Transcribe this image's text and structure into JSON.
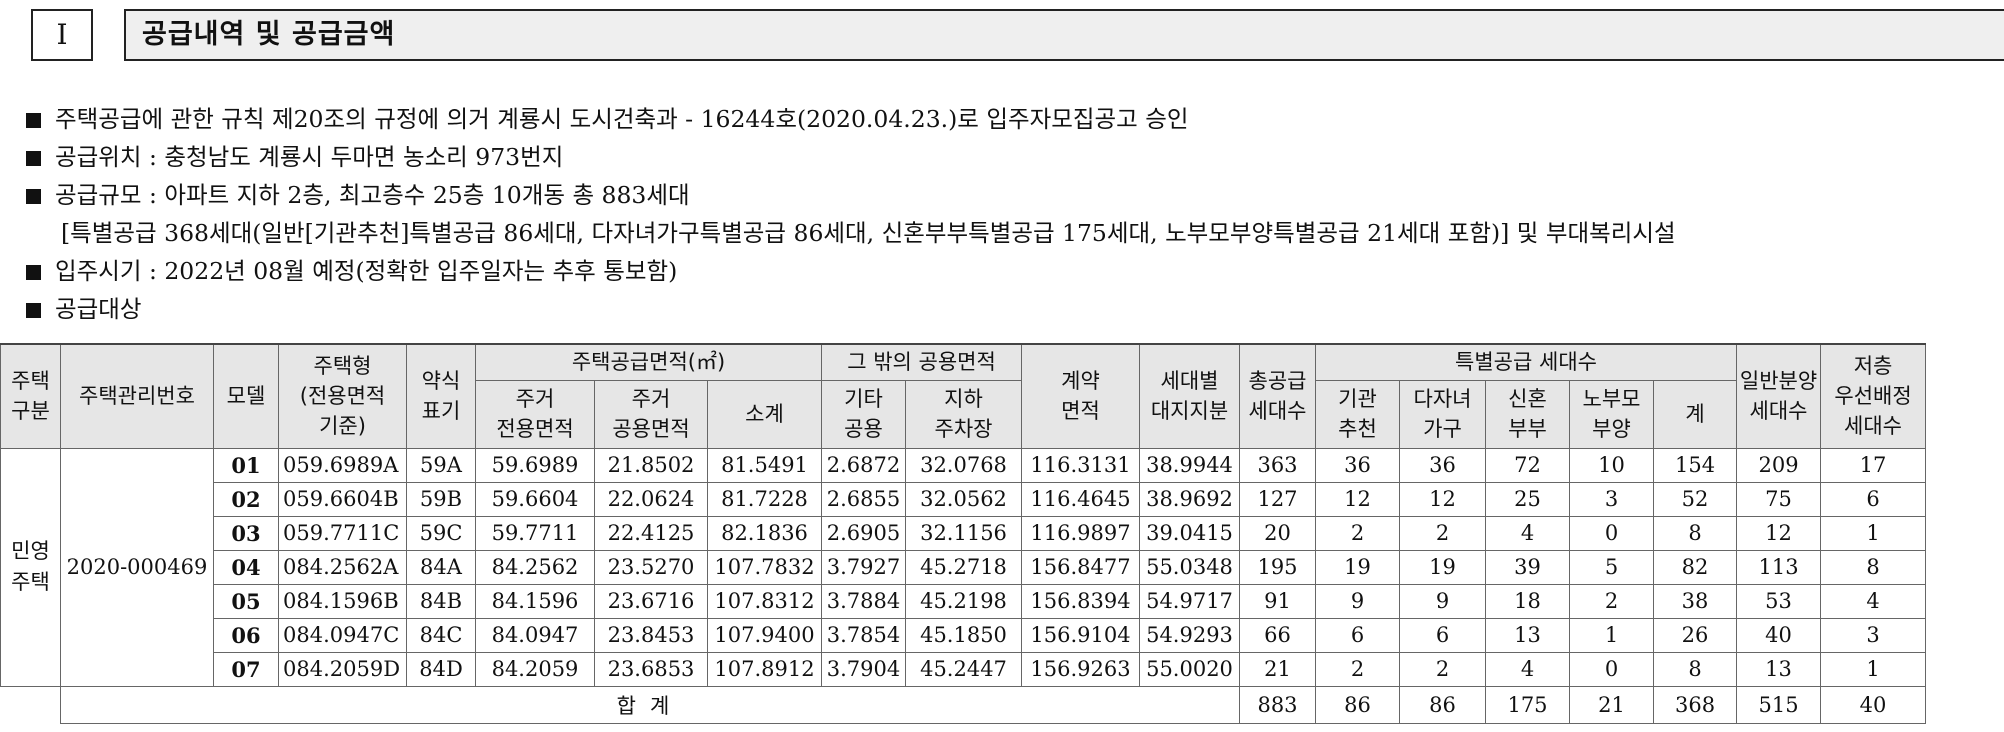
{
  "section": {
    "number": "I",
    "title": "공급내역 및 공급금액"
  },
  "bullets": [
    "주택공급에 관한 규칙 제20조의 규정에 의거 계룡시 도시건축과 - 16244호(2020.04.23.)로 입주자모집공고 승인",
    "공급위치 : 충청남도 계룡시 두마면 농소리 973번지",
    "공급규모 : 아파트 지하 2층, 최고층수 25층 10개동 총 883세대"
  ],
  "bullet_indent": "[특별공급 368세대(일반[기관추천]특별공급 86세대, 다자녀가구특별공급 86세대, 신혼부부특별공급 175세대, 노부모부양특별공급 21세대 포함)] 및 부대복리시설",
  "bullets2": [
    "입주시기 : 2022년 08월 예정(정확한 입주일자는 추후 통보함)",
    "공급대상"
  ],
  "headers": {
    "housing_type": "주택\n구분",
    "mgmt_no": "주택관리번호",
    "model": "모델",
    "type": "주택형\n(전용면적\n기준)",
    "abbr": "약식\n표기",
    "supply_area": "주택공급면적(㎡)",
    "excl": "주거\n전용면적",
    "common": "주거\n공용면적",
    "subtotal": "소계",
    "other_common": "그 밖의 공용면적",
    "etc_common": "기타\n공용",
    "parking": "지하\n주차장",
    "contract_area": "계약\n면적",
    "land_share": "세대별\n대지지분",
    "total_units": "총공급\n세대수",
    "special": "특별공급 세대수",
    "inst": "기관\n추천",
    "multi": "다자녀\n가구",
    "newlywed": "신혼\n부부",
    "elderly": "노부모\n부양",
    "sum": "계",
    "general": "일반분양\n세대수",
    "lowfloor": "저층\n우선배정\n세대수"
  },
  "housing_type_value": "민영\n주택",
  "mgmt_no_value": "2020-000469",
  "rows": [
    [
      "01",
      "059.6989A",
      "59A",
      "59.6989",
      "21.8502",
      "81.5491",
      "2.6872",
      "32.0768",
      "116.3131",
      "38.9944",
      "363",
      "36",
      "36",
      "72",
      "10",
      "154",
      "209",
      "17"
    ],
    [
      "02",
      "059.6604B",
      "59B",
      "59.6604",
      "22.0624",
      "81.7228",
      "2.6855",
      "32.0562",
      "116.4645",
      "38.9692",
      "127",
      "12",
      "12",
      "25",
      "3",
      "52",
      "75",
      "6"
    ],
    [
      "03",
      "059.7711C",
      "59C",
      "59.7711",
      "22.4125",
      "82.1836",
      "2.6905",
      "32.1156",
      "116.9897",
      "39.0415",
      "20",
      "2",
      "2",
      "4",
      "0",
      "8",
      "12",
      "1"
    ],
    [
      "04",
      "084.2562A",
      "84A",
      "84.2562",
      "23.5270",
      "107.7832",
      "3.7927",
      "45.2718",
      "156.8477",
      "55.0348",
      "195",
      "19",
      "19",
      "39",
      "5",
      "82",
      "113",
      "8"
    ],
    [
      "05",
      "084.1596B",
      "84B",
      "84.1596",
      "23.6716",
      "107.8312",
      "3.7884",
      "45.2198",
      "156.8394",
      "54.9717",
      "91",
      "9",
      "9",
      "18",
      "2",
      "38",
      "53",
      "4"
    ],
    [
      "06",
      "084.0947C",
      "84C",
      "84.0947",
      "23.8453",
      "107.9400",
      "3.7854",
      "45.1850",
      "156.9104",
      "54.9293",
      "66",
      "6",
      "6",
      "13",
      "1",
      "26",
      "40",
      "3"
    ],
    [
      "07",
      "084.2059D",
      "84D",
      "84.2059",
      "23.6853",
      "107.8912",
      "3.7904",
      "45.2447",
      "156.9263",
      "55.0020",
      "21",
      "2",
      "2",
      "4",
      "0",
      "8",
      "13",
      "1"
    ]
  ],
  "total": {
    "label": "합계",
    "values": [
      "883",
      "86",
      "86",
      "175",
      "21",
      "368",
      "515",
      "40"
    ]
  }
}
